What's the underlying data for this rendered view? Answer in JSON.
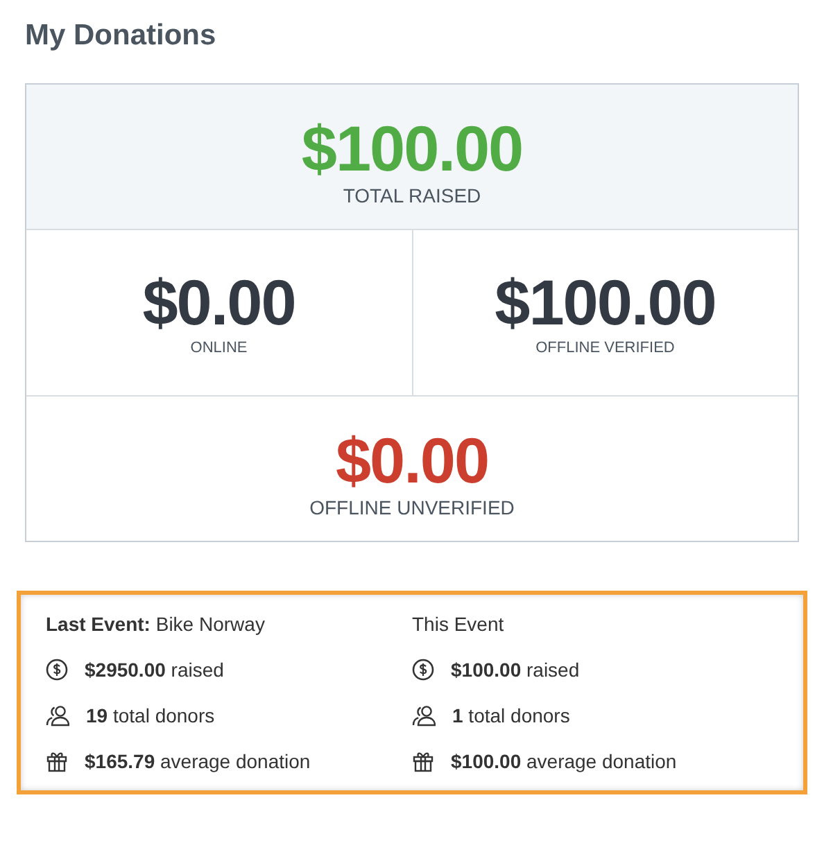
{
  "title": "My Donations",
  "totals": [
    {
      "amount": "$100.00",
      "label": "TOTAL RAISED",
      "color": "#52ac45"
    },
    {
      "amount": "$0.00",
      "label": "ONLINE",
      "color": "#333a44"
    },
    {
      "amount": "$100.00",
      "label": "OFFLINE VERIFIED",
      "color": "#333a44"
    },
    {
      "amount": "$0.00",
      "label": "OFFLINE UNVERIFIED",
      "color": "#cc3f2e"
    }
  ],
  "events": [
    {
      "heading": "**Last Event:** Bike Norway",
      "stats": [
        {
          "kind": "money",
          "text": "**$2950.00** raised"
        },
        {
          "kind": "donors",
          "text": "**19** total donors"
        },
        {
          "kind": "gift",
          "text": "**$165.79** average donation"
        }
      ]
    },
    {
      "heading": "This Event",
      "stats": [
        {
          "kind": "money",
          "text": "**$100.00** raised"
        },
        {
          "kind": "donors",
          "text": "**1** total donors"
        },
        {
          "kind": "gift",
          "text": "**$100.00** average donation"
        }
      ]
    }
  ]
}
